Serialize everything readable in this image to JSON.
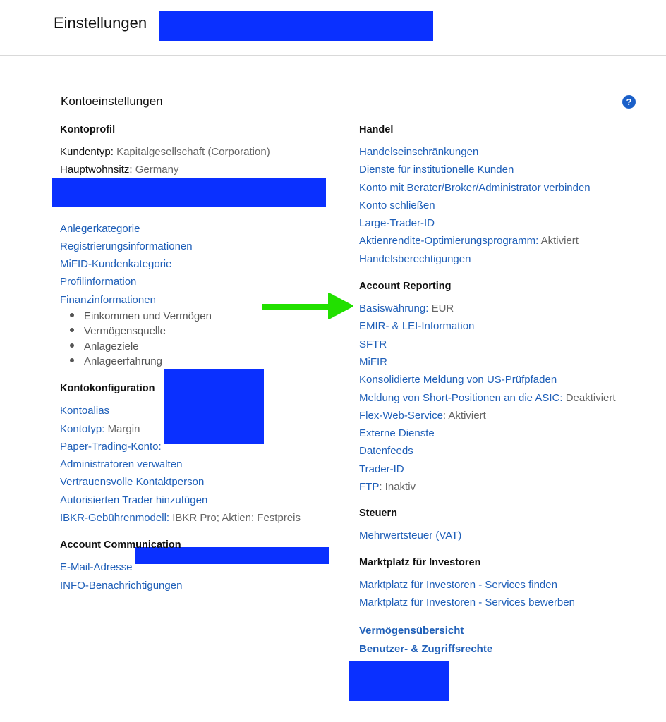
{
  "page": {
    "title": "Einstellungen"
  },
  "section": {
    "title": "Kontoeinstellungen",
    "help_icon": "question-circle-icon",
    "help_glyph": "?"
  },
  "colors": {
    "link": "#1f5fb8",
    "redaction": "#0a30ff",
    "arrow": "#22e000",
    "help": "#1a5fc8"
  },
  "kontoprofil": {
    "title": "Kontoprofil",
    "kundentyp_label": "Kundentyp:",
    "kundentyp_value": "Kapitalgesellschaft (Corporation)",
    "wohnsitz_label": "Hauptwohnsitz:",
    "wohnsitz_value": "Germany",
    "links": [
      "Anlegerkategorie",
      "Registrierungsinformationen",
      "MiFID-Kundenkategorie",
      "Profilinformation",
      "Finanzinformationen"
    ],
    "sub_items": [
      "Einkommen und Vermögen",
      "Vermögensquelle",
      "Anlageziele",
      "Anlageerfahrung"
    ]
  },
  "kontokonfiguration": {
    "title": "Kontokonfiguration",
    "kontoalias": "Kontoalias",
    "kontotyp_label": "Kontotyp:",
    "kontotyp_value": "Margin",
    "paper": "Paper-Trading-Konto:",
    "admins": "Administratoren verwalten",
    "vertrauens": "Vertrauensvolle Kontaktperson",
    "trader": "Autorisierten Trader hinzufügen",
    "gebuehr_label": "IBKR-Gebührenmodell:",
    "gebuehr_value": "IBKR Pro; Aktien: Festpreis"
  },
  "communication": {
    "title": "Account Communication",
    "email": "E-Mail-Adresse",
    "info": "INFO-Benachrichtigungen"
  },
  "handel": {
    "title": "Handel",
    "links": [
      "Handelseinschränkungen",
      "Dienste für institutionelle Kunden",
      "Konto mit Berater/Broker/Administrator verbinden",
      "Konto schließen",
      "Large-Trader-ID"
    ],
    "aktienrendite_label": "Aktienrendite-Optimierungsprogramm:",
    "aktienrendite_value": "Aktiviert",
    "berechtigungen": "Handelsberechtigungen"
  },
  "reporting": {
    "title": "Account Reporting",
    "basis_label": "Basiswährung:",
    "basis_value": "EUR",
    "emir": "EMIR- & LEI-Information",
    "sftr": "SFTR",
    "mifir": "MiFIR",
    "us_pruef": "Konsolidierte Meldung von US-Prüfpfaden",
    "asic_label": "Meldung von Short-Positionen an die ASIC:",
    "asic_value": "Deaktiviert",
    "flex_label": "Flex-Web-Service",
    "flex_value": ": Aktiviert",
    "externe": "Externe Dienste",
    "datenfeeds": "Datenfeeds",
    "trader_id": "Trader-ID",
    "ftp_label": "FTP",
    "ftp_value": ": Inaktiv"
  },
  "steuern": {
    "title": "Steuern",
    "vat": "Mehrwertsteuer (VAT)"
  },
  "marktplatz": {
    "title": "Marktplatz für Investoren",
    "finden": "Marktplatz für Investoren - Services finden",
    "bewerben": "Marktplatz für Investoren - Services bewerben"
  },
  "extra": {
    "vermoegen": "Vermögensübersicht",
    "benutzer": "Benutzer- & Zugriffsrechte"
  }
}
